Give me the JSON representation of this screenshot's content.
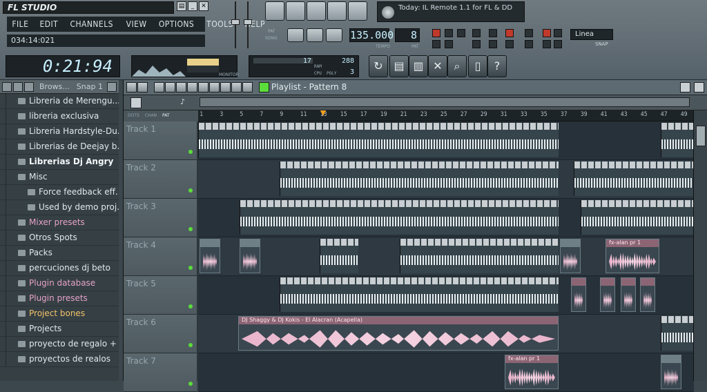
{
  "app": {
    "title": "FL STUDIO",
    "hint": "034:14:021"
  },
  "menu": [
    "FILE",
    "EDIT",
    "CHANNELS",
    "VIEW",
    "OPTIONS",
    "TOOLS",
    "HELP"
  ],
  "news": {
    "text": "Today: IL Remote 1.1 for FL & DD"
  },
  "transport": {
    "tempo": "135.000",
    "tempo_label": "TEMPO",
    "pattern": "8",
    "pattern_label": "PAT",
    "pat_mode": "PAT",
    "song_mode": "SONG"
  },
  "time_display": "0:21:94",
  "monitor_label": "MONITOR",
  "cpu": {
    "ram": "17",
    "poly_max": "288",
    "cpu_label": "CPU",
    "poly_label": "POLY",
    "ram_label": "RAM",
    "poly": "3"
  },
  "snap": {
    "value": "Linea",
    "label": "SNAP"
  },
  "browser": {
    "snap_label": "Snap 1",
    "browse_label": "Brows...",
    "items": [
      {
        "label": "Libreria de Merengu...",
        "style": ""
      },
      {
        "label": "libreria exclusiva",
        "style": ""
      },
      {
        "label": "Libreria Hardstyle-Du...",
        "style": ""
      },
      {
        "label": "Librerias de Deejay b...",
        "style": ""
      },
      {
        "label": "Librerias Dj Angry",
        "style": "bold"
      },
      {
        "label": "Misc",
        "style": ""
      },
      {
        "label": "Force feedback eff...",
        "style": "sub"
      },
      {
        "label": "Used by demo proj...",
        "style": "sub"
      },
      {
        "label": "Mixer presets",
        "style": "pink"
      },
      {
        "label": "Otros Spots",
        "style": ""
      },
      {
        "label": "Packs",
        "style": ""
      },
      {
        "label": "percuciones dj beto",
        "style": ""
      },
      {
        "label": "Plugin database",
        "style": "pink"
      },
      {
        "label": "Plugin presets",
        "style": "pink"
      },
      {
        "label": "Project bones",
        "style": "orange"
      },
      {
        "label": "Projects",
        "style": ""
      },
      {
        "label": "proyecto de regalo + ...",
        "style": ""
      },
      {
        "label": "proyectos de realos",
        "style": ""
      }
    ]
  },
  "playlist": {
    "title": "Playlist - Pattern 8",
    "tabs": [
      "DOTS",
      "CHAN",
      "PAT"
    ],
    "ruler": [
      "1",
      "3",
      "5",
      "7",
      "9",
      "11",
      "13",
      "15",
      "17",
      "19",
      "21",
      "23",
      "25",
      "27",
      "29",
      "31",
      "33",
      "35",
      "37",
      "39",
      "41",
      "43",
      "45",
      "47",
      "49"
    ],
    "tracks": [
      "Track 1",
      "Track 2",
      "Track 3",
      "Track 4",
      "Track 5",
      "Track 6",
      "Track 7"
    ],
    "clips": {
      "acapella": "DJ Shaggy & DJ Kokis - El Alacran (Acapella)",
      "fx1": "fx-alan pr 1",
      "fx2": "fx-alan pr 1"
    }
  }
}
